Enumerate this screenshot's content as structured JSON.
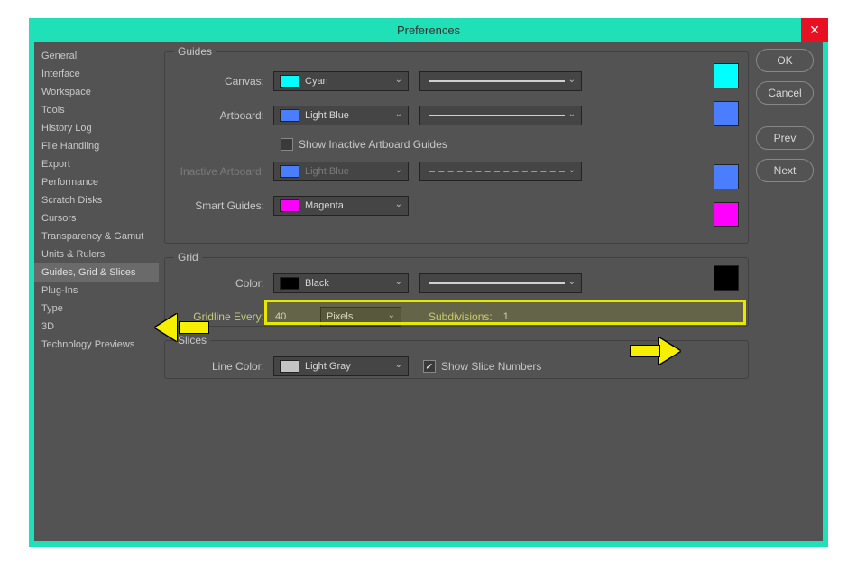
{
  "dialog": {
    "title": "Preferences",
    "close_glyph": "✕"
  },
  "sidebar": {
    "items": [
      {
        "label": "General"
      },
      {
        "label": "Interface"
      },
      {
        "label": "Workspace"
      },
      {
        "label": "Tools"
      },
      {
        "label": "History Log"
      },
      {
        "label": "File Handling"
      },
      {
        "label": "Export"
      },
      {
        "label": "Performance"
      },
      {
        "label": "Scratch Disks"
      },
      {
        "label": "Cursors"
      },
      {
        "label": "Transparency & Gamut"
      },
      {
        "label": "Units & Rulers"
      },
      {
        "label": "Guides, Grid & Slices",
        "selected": true
      },
      {
        "label": "Plug-Ins"
      },
      {
        "label": "Type"
      },
      {
        "label": "3D"
      },
      {
        "label": "Technology Previews"
      }
    ]
  },
  "groups": {
    "guides": {
      "legend": "Guides",
      "canvas_label": "Canvas:",
      "canvas_color_name": "Cyan",
      "canvas_color_hex": "#00ffff",
      "artboard_label": "Artboard:",
      "artboard_color_name": "Light Blue",
      "artboard_color_hex": "#4a7eff",
      "show_inactive_label": "Show Inactive Artboard Guides",
      "show_inactive_checked": false,
      "inactive_label": "Inactive Artboard:",
      "inactive_color_name": "Light Blue",
      "inactive_color_hex": "#4a7eff",
      "smart_label": "Smart Guides:",
      "smart_color_name": "Magenta",
      "smart_color_hex": "#ff00ff"
    },
    "grid": {
      "legend": "Grid",
      "color_label": "Color:",
      "color_name": "Black",
      "color_hex": "#000000",
      "gridline_label": "Gridline Every:",
      "gridline_value": "40",
      "gridline_unit": "Pixels",
      "subdiv_label": "Subdivisions:",
      "subdiv_value": "1"
    },
    "slices": {
      "legend": "Slices",
      "line_color_label": "Line Color:",
      "line_color_name": "Light Gray",
      "line_color_hex": "#c4c4c4",
      "show_numbers_label": "Show Slice Numbers",
      "show_numbers_checked": true
    }
  },
  "buttons": {
    "ok": "OK",
    "cancel": "Cancel",
    "prev": "Prev",
    "next": "Next"
  }
}
